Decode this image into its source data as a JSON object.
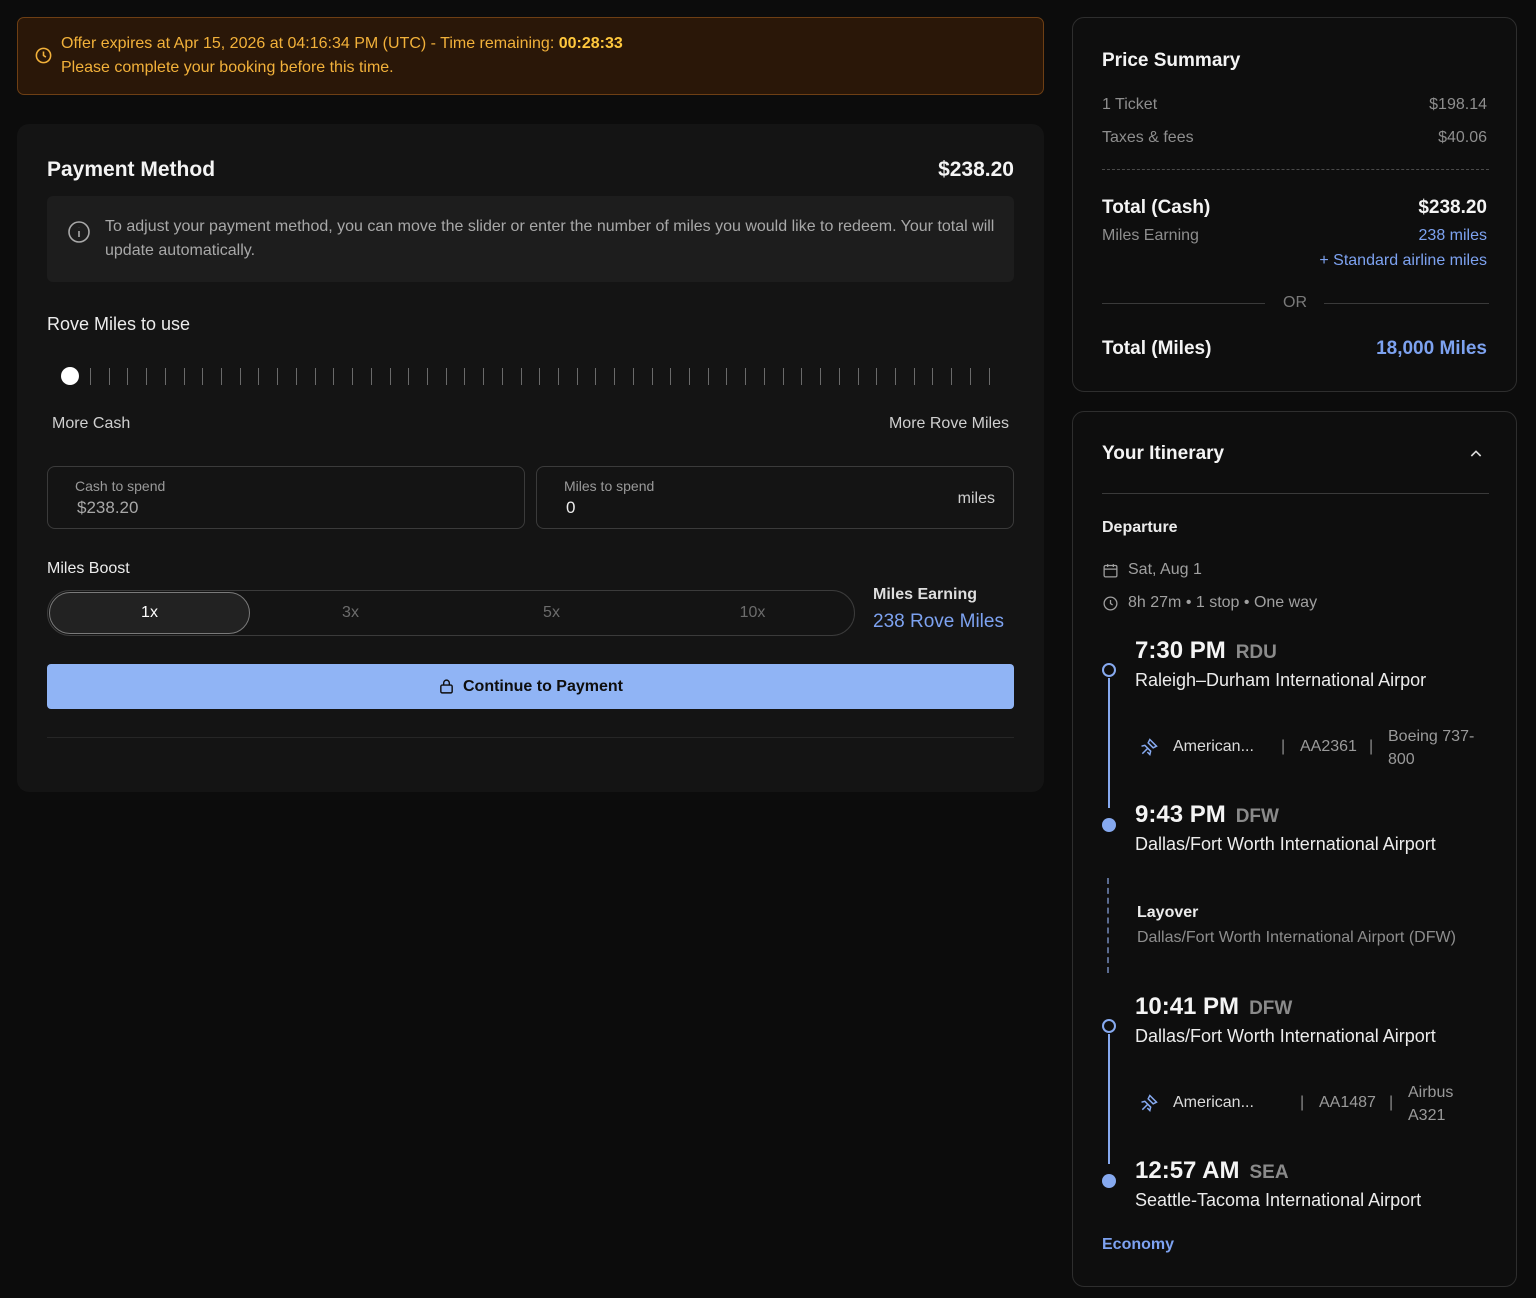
{
  "offer_banner": {
    "line1_prefix": "Offer expires at Apr 15, 2026 at 04:16:34 PM (UTC) - Time remaining: ",
    "time_remaining": "00:28:33",
    "line2": "Please complete your booking before this time."
  },
  "payment": {
    "title": "Payment Method",
    "total": "$238.20",
    "info_text": "To adjust your payment method, you can move the slider or enter the number of miles you would like to redeem. Your total will update automatically.",
    "rove_miles_label": "Rove Miles to use",
    "slider_position": 0,
    "slider_left_label": "More Cash",
    "slider_right_label": "More Rove Miles",
    "cash_field": {
      "label": "Cash to spend",
      "value": "$238.20"
    },
    "miles_field": {
      "label": "Miles to spend",
      "value": "0",
      "suffix": "miles"
    },
    "boost_label": "Miles Boost",
    "boost_options": [
      "1x",
      "3x",
      "5x",
      "10x"
    ],
    "boost_selected": "1x",
    "miles_earning_label": "Miles Earning",
    "miles_earning_value": "238 Rove Miles",
    "cta_label": "Continue to Payment"
  },
  "price_summary": {
    "title": "Price Summary",
    "ticket_label": "1 Ticket",
    "ticket_value": "$198.14",
    "taxes_label": "Taxes & fees",
    "taxes_value": "$40.06",
    "total_cash_label": "Total (Cash)",
    "total_cash_value": "$238.20",
    "miles_earning_label": "Miles Earning",
    "miles_earning_value": "238 miles",
    "standard_miles": "+ Standard airline miles",
    "or_label": "OR",
    "total_miles_label": "Total (Miles)",
    "total_miles_value": "18,000 Miles"
  },
  "itinerary": {
    "title": "Your Itinerary",
    "section": "Departure",
    "date": "Sat, Aug 1",
    "summary": "8h 27m • 1 stop • One way",
    "segments": [
      {
        "dep_time": "7:30 PM",
        "dep_code": "RDU",
        "dep_airport": "Raleigh–Durham International Airpor",
        "airline": "American...",
        "flight": "AA2361",
        "aircraft": "Boeing 737-800",
        "arr_time": "9:43 PM",
        "arr_code": "DFW",
        "arr_airport": "Dallas/Fort Worth International Airport"
      },
      {
        "dep_time": "10:41 PM",
        "dep_code": "DFW",
        "dep_airport": "Dallas/Fort Worth International Airport",
        "airline": "American...",
        "flight": "AA1487",
        "aircraft": "Airbus A321",
        "arr_time": "12:57 AM",
        "arr_code": "SEA",
        "arr_airport": "Seattle-Tacoma International Airport"
      }
    ],
    "layover_title": "Layover",
    "layover_airport": "Dallas/Fort Worth International Airport (DFW)",
    "cabin": "Economy"
  },
  "colors": {
    "accent_blue": "#7da2f0",
    "cta_blue": "#90b4f5",
    "warning_text": "#f2b13a",
    "warning_bg": "#2a1708"
  }
}
